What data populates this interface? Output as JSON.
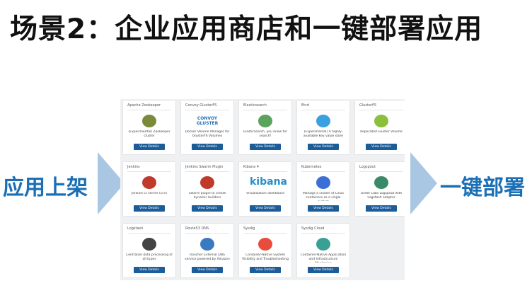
{
  "slide": {
    "title": "场景2：企业应用商店和一键部署应用",
    "left_label": "应用上架",
    "right_label": "一键部署"
  },
  "store": {
    "button_label": "View Details",
    "cards": [
      {
        "name": "Apache Zookeeper",
        "logo": "zookeeper-icon",
        "logo_color": "#7a8a3a",
        "desc": "(Experimental) Zookeeper cluster"
      },
      {
        "name": "Convoy GlusterFS",
        "logo_text": "CONVOY GLUSTER",
        "logo_color": "#1f6fb4",
        "desc": "Docker Volume Manager for GlusterFS Volumes"
      },
      {
        "name": "Elasticsearch",
        "logo": "elasticsearch-icon",
        "logo_color": "#5aa35a",
        "desc": "Elasticsearch, you know for search!"
      },
      {
        "name": "Etcd",
        "logo": "etcd-icon",
        "logo_color": "#3aa0e0",
        "desc": "(Experimental) A highly-available key value store"
      },
      {
        "name": "GlusterFS",
        "logo": "gluster-icon",
        "logo_color": "#8bbf3c",
        "desc": "Replicated Gluster Volume"
      },
      {
        "name": "Jenkins",
        "logo": "jenkins-icon",
        "logo_color": "#c0392b",
        "desc": "Jenkins CI server (LTS)"
      },
      {
        "name": "Jenkins Swarm Plugin",
        "logo": "jenkins-swarm-icon",
        "logo_color": "#c0392b",
        "desc": "Swarm plugin to create dynamic builders"
      },
      {
        "name": "Kibana 4",
        "logo_text": "kibana",
        "logo_color": "#2a8fc7",
        "desc": "Visualization dashboard"
      },
      {
        "name": "Kubernetes",
        "logo": "kubernetes-icon",
        "logo_color": "#3b6fd6",
        "desc": "Manage a cluster of Linux containers as a single system"
      },
      {
        "name": "Logspout",
        "logo": "logspout-icon",
        "logo_color": "#3a8a6a",
        "desc": "Glider Labs Logspout with Logstash adapter"
      },
      {
        "name": "Logstash",
        "logo": "logstash-icon",
        "logo_color": "#444444",
        "desc": "Centralize data processing of all types"
      },
      {
        "name": "Route53 DNS",
        "logo": "route53-icon",
        "logo_color": "#3a7ac0",
        "desc": "Rancher External DNS service powered by Amazon"
      },
      {
        "name": "Sysdig",
        "logo": "sysdig-icon",
        "logo_color": "#e84c3d",
        "desc": "Container-Native System Visibility and Troubleshooting"
      },
      {
        "name": "Sysdig Cloud",
        "logo": "sysdig-cloud-icon",
        "logo_color": "#3aa095",
        "desc": "Container-Native Application and Infrastructure Monitoring"
      }
    ]
  }
}
